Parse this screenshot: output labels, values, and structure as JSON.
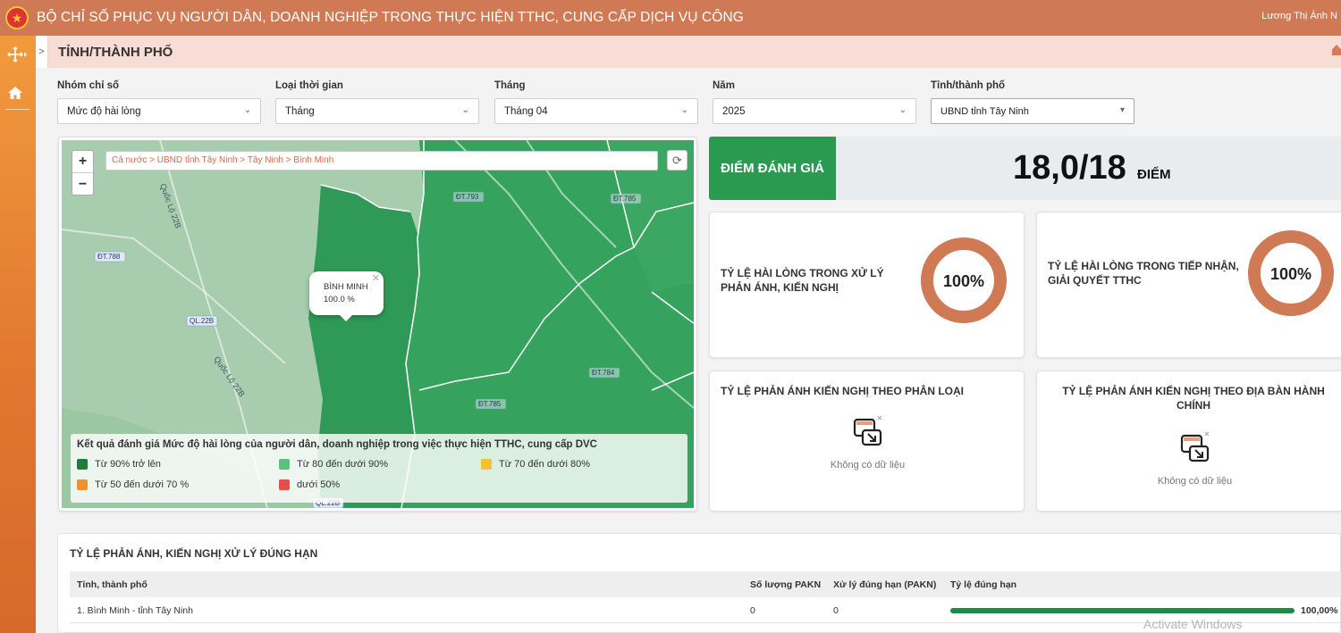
{
  "header": {
    "title": "BỘ CHỈ SỐ PHỤC VỤ NGƯỜI DÂN, DOANH NGHIỆP TRONG THỰC HIỆN TTHC, CUNG CẤP DỊCH VỤ CÔNG",
    "user": "Lương Thị Ánh N"
  },
  "subheader": {
    "title": "TỈNH/THÀNH PHỐ"
  },
  "filters": [
    {
      "label": "Nhóm chỉ số",
      "value": "Mức độ hài lòng"
    },
    {
      "label": "Loại thời gian",
      "value": "Tháng"
    },
    {
      "label": "Tháng",
      "value": "Tháng 04"
    },
    {
      "label": "Năm",
      "value": "2025"
    },
    {
      "label": "Tỉnh/thành phố",
      "value": "UBND tỉnh Tây Ninh"
    }
  ],
  "map": {
    "breadcrumb": "Cả nước > UBND tỉnh Tây Ninh > Tây Ninh > Bình Minh",
    "popup": {
      "name": "BÌNH MINH",
      "value": "100.0 %"
    },
    "road_labels": [
      "ĐT.788",
      "QL.22B",
      "ĐT.793",
      "ĐT.785",
      "ĐT.784",
      "ĐT.785",
      "QL.22B",
      "Quốc Lộ 22B",
      "Quốc Lộ 22B"
    ],
    "legend": {
      "title": "Kết quả đánh giá Mức độ hài lòng của người dân, doanh nghiệp trong việc thực hiện TTHC, cung cấp DVC",
      "items": [
        {
          "label": "Từ 90% trở lên",
          "color": "#1e7d3c"
        },
        {
          "label": "Từ 80 đến dưới 90%",
          "color": "#5cc17d"
        },
        {
          "label": "Từ 70 đến dưới 80%",
          "color": "#f1c232"
        },
        {
          "label": "Từ 50 đến dưới 70 %",
          "color": "#f0922e"
        },
        {
          "label": "dưới 50%",
          "color": "#e84c4c"
        }
      ]
    }
  },
  "score": {
    "label": "ĐIỂM ĐÁNH GIÁ",
    "value": "18,0/18",
    "unit": "ĐIỂM"
  },
  "cards": {
    "satisfaction_feedback": {
      "title": "TỶ LỆ HÀI LÒNG TRONG XỬ LÝ PHẢN ÁNH, KIẾN NGHỊ",
      "percent": 100,
      "label": "100%"
    },
    "satisfaction_tthc": {
      "title": "TỶ LỆ HÀI LÒNG TRONG TIẾP NHẬN, GIẢI QUYẾT TTHC",
      "percent": 100,
      "label": "100%"
    },
    "by_category": {
      "title": "TỶ LỆ PHẢN ÁNH KIẾN NGHỊ THEO PHÂN LOẠI",
      "empty": "Không có dữ liệu"
    },
    "by_area": {
      "title": "TỶ LỆ PHẢN ÁNH KIẾN NGHỊ THEO ĐỊA BÀN HÀNH CHÍNH",
      "empty": "Không có dữ liệu"
    }
  },
  "table": {
    "title": "TỶ LỆ PHẢN ÁNH, KIẾN NGHỊ XỬ LÝ ĐÚNG HẠN",
    "headers": [
      "Tỉnh, thành phố",
      "Số lượng PAKN",
      "Xử lý đúng hạn (PAKN)",
      "Tỷ lệ đúng hạn"
    ],
    "rows": [
      {
        "name": "1. Bình Minh - tỉnh Tây Ninh",
        "count": "0",
        "ontime": "0",
        "rate": 100,
        "rate_label": "100,00%"
      }
    ]
  },
  "watermark": "Activate Windows",
  "colors": {
    "header": "#cf7a55",
    "accent_green": "#2a9a50",
    "donut": "#cf7a55"
  },
  "icons": [
    "emblem-icon",
    "menu-icon",
    "home-icon",
    "refresh-icon",
    "chevron-down-icon",
    "no-data-icon"
  ]
}
